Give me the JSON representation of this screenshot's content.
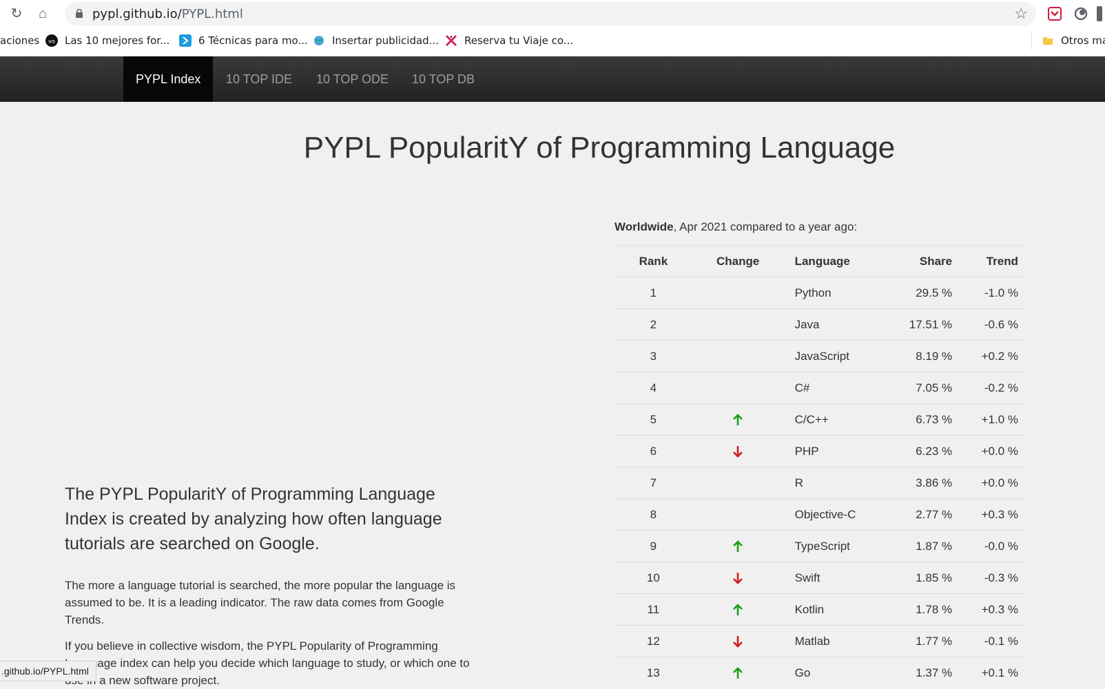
{
  "browser": {
    "url_host": "pypl.github.io/",
    "url_path": "PYPL.html",
    "bookmarks": [
      {
        "label": "aciones"
      },
      {
        "label": "Las 10 mejores for..."
      },
      {
        "label": "6 Técnicas para mo..."
      },
      {
        "label": "Insertar publicidad..."
      },
      {
        "label": "Reserva tu Viaje co..."
      },
      {
        "label": "Otros mar"
      }
    ],
    "status_url": ".github.io/PYPL.html"
  },
  "nav": {
    "tabs": [
      "PYPL Index",
      "10 TOP IDE",
      "10 TOP ODE",
      "10 TOP DB"
    ]
  },
  "page": {
    "title": "PYPL PopularitY of Programming Language",
    "lead": "The PYPL PopularitY of Programming Language Index is created by analyzing how often language tutorials are searched on Google.",
    "para1": "The more a language tutorial is searched, the more popular the language is assumed to be. It is a leading indicator. The raw data comes from Google Trends.",
    "para2": "If you believe in collective wisdom, the PYPL Popularity of Programming Language index can help you decide which language to study, or which one to use in a new software project."
  },
  "table": {
    "caption_bold": "Worldwide",
    "caption_rest": ", Apr 2021 compared to a year ago:",
    "headers": [
      "Rank",
      "Change",
      "Language",
      "Share",
      "Trend"
    ],
    "rows": [
      {
        "rank": "1",
        "change": "",
        "language": "Python",
        "share": "29.5 %",
        "trend": "-1.0 %"
      },
      {
        "rank": "2",
        "change": "",
        "language": "Java",
        "share": "17.51 %",
        "trend": "-0.6 %"
      },
      {
        "rank": "3",
        "change": "",
        "language": "JavaScript",
        "share": "8.19 %",
        "trend": "+0.2 %"
      },
      {
        "rank": "4",
        "change": "",
        "language": "C#",
        "share": "7.05 %",
        "trend": "-0.2 %"
      },
      {
        "rank": "5",
        "change": "up",
        "language": "C/C++",
        "share": "6.73 %",
        "trend": "+1.0 %"
      },
      {
        "rank": "6",
        "change": "down",
        "language": "PHP",
        "share": "6.23 %",
        "trend": "+0.0 %"
      },
      {
        "rank": "7",
        "change": "",
        "language": "R",
        "share": "3.86 %",
        "trend": "+0.0 %"
      },
      {
        "rank": "8",
        "change": "",
        "language": "Objective-C",
        "share": "2.77 %",
        "trend": "+0.3 %"
      },
      {
        "rank": "9",
        "change": "up",
        "language": "TypeScript",
        "share": "1.87 %",
        "trend": "-0.0 %"
      },
      {
        "rank": "10",
        "change": "down",
        "language": "Swift",
        "share": "1.85 %",
        "trend": "-0.3 %"
      },
      {
        "rank": "11",
        "change": "up",
        "language": "Kotlin",
        "share": "1.78 %",
        "trend": "+0.3 %"
      },
      {
        "rank": "12",
        "change": "down",
        "language": "Matlab",
        "share": "1.77 %",
        "trend": "-0.1 %"
      },
      {
        "rank": "13",
        "change": "up",
        "language": "Go",
        "share": "1.37 %",
        "trend": "+0.1 %"
      }
    ]
  },
  "colors": {
    "up": "#1a9e1a",
    "down": "#d01c1c",
    "navbar": "#222222"
  }
}
